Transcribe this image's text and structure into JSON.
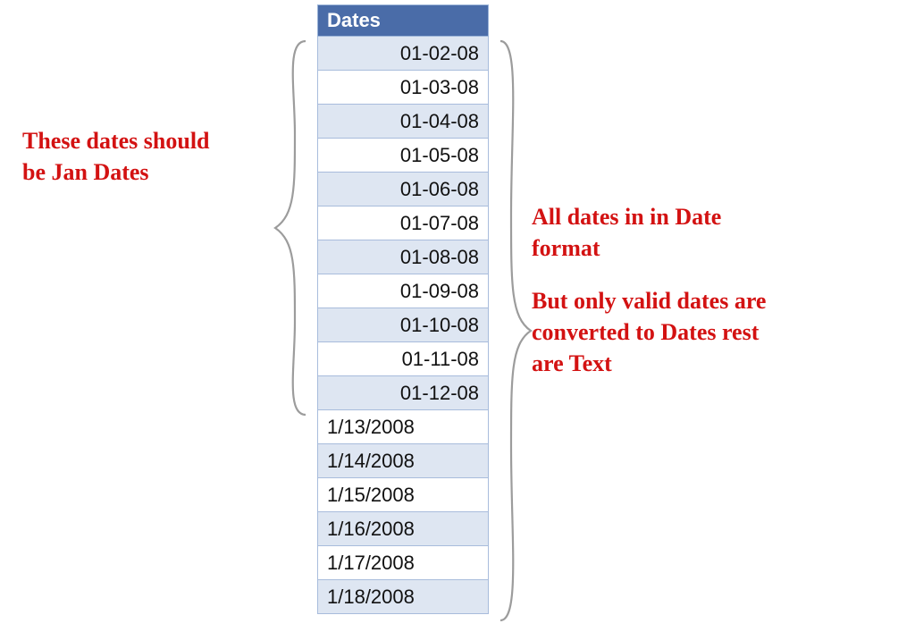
{
  "table": {
    "header": "Dates",
    "rows": [
      {
        "value": "01-02-08",
        "align": "right",
        "band": true
      },
      {
        "value": "01-03-08",
        "align": "right",
        "band": false
      },
      {
        "value": "01-04-08",
        "align": "right",
        "band": true
      },
      {
        "value": "01-05-08",
        "align": "right",
        "band": false
      },
      {
        "value": "01-06-08",
        "align": "right",
        "band": true
      },
      {
        "value": "01-07-08",
        "align": "right",
        "band": false
      },
      {
        "value": "01-08-08",
        "align": "right",
        "band": true
      },
      {
        "value": "01-09-08",
        "align": "right",
        "band": false
      },
      {
        "value": "01-10-08",
        "align": "right",
        "band": true
      },
      {
        "value": "01-11-08",
        "align": "right",
        "band": false
      },
      {
        "value": "01-12-08",
        "align": "right",
        "band": true
      },
      {
        "value": "1/13/2008",
        "align": "left",
        "band": false
      },
      {
        "value": "1/14/2008",
        "align": "left",
        "band": true
      },
      {
        "value": "1/15/2008",
        "align": "left",
        "band": false
      },
      {
        "value": "1/16/2008",
        "align": "left",
        "band": true
      },
      {
        "value": "1/17/2008",
        "align": "left",
        "band": false
      },
      {
        "value": "1/18/2008",
        "align": "left",
        "band": true
      }
    ]
  },
  "annotations": {
    "left": {
      "line1": "These dates should",
      "line2": "be Jan Dates"
    },
    "right": {
      "line1": "All dates in in Date",
      "line2": "format",
      "line3": "But only valid dates are",
      "line4": "converted to Dates rest",
      "line5": "are Text"
    }
  },
  "colors": {
    "header_bg": "#4a6ca8",
    "band_bg": "#dee6f2",
    "note_fg": "#d31212",
    "brace_fg": "#9c9c9c"
  }
}
